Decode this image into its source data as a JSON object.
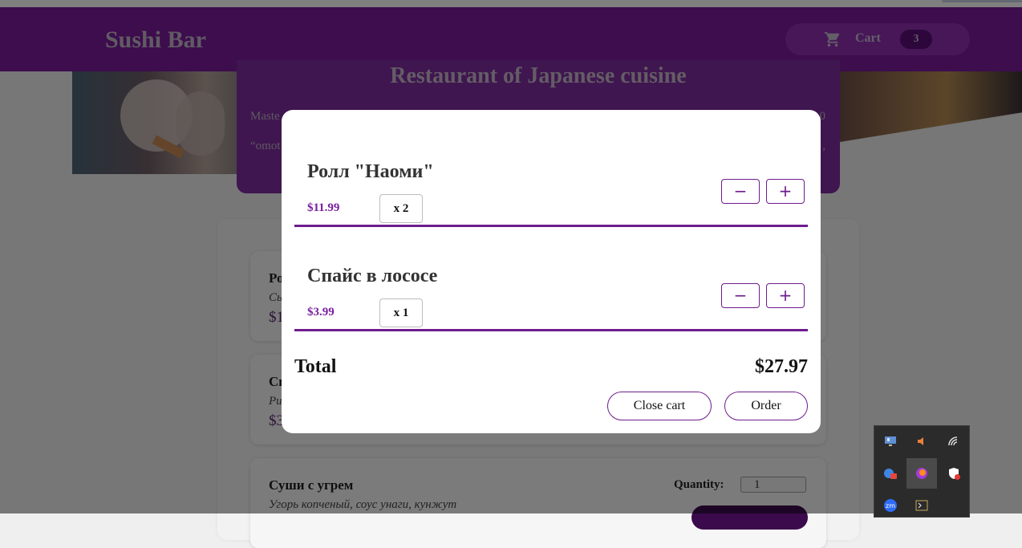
{
  "header": {
    "brand": "Sushi Bar",
    "cart_label": "Cart",
    "cart_count": "3"
  },
  "hero": {
    "title": "Restaurant of Japanese cuisine",
    "text_line1": "Maste",
    "text_line2": "“omot",
    "text_edge1": "0",
    "text_edge2": ","
  },
  "products": [
    {
      "name": "Ро",
      "desc": "Сы",
      "price": "$1"
    },
    {
      "name": "Сп",
      "desc": "Ри",
      "price": "$3"
    },
    {
      "name": "Суши с угрем",
      "desc": "Угорь копченый, соус унаги, кунжут",
      "quantity_label": "Quantity:",
      "quantity_value": "1"
    }
  ],
  "cart": {
    "items": [
      {
        "name": "Ролл \"Наоми\"",
        "price": "$11.99",
        "qty": "x 2",
        "minus": "−",
        "plus": "+"
      },
      {
        "name": "Спайс в лососе",
        "price": "$3.99",
        "qty": "x 1",
        "minus": "−",
        "plus": "+"
      }
    ],
    "total_label": "Total",
    "total_value": "$27.97",
    "close_label": "Close cart",
    "order_label": "Order"
  },
  "tray": {
    "icons": [
      "display-icon",
      "volume-muted-icon",
      "wifi-icon",
      "browser-badge-icon",
      "firefox-icon",
      "security-shield-icon",
      "zoom-icon",
      "terminal-icon"
    ],
    "zoom_text": "zm"
  },
  "colors": {
    "accent": "#6e1c8e",
    "header": "#7a1a9a",
    "overlay": "rgba(0,0,0,0.5)"
  }
}
